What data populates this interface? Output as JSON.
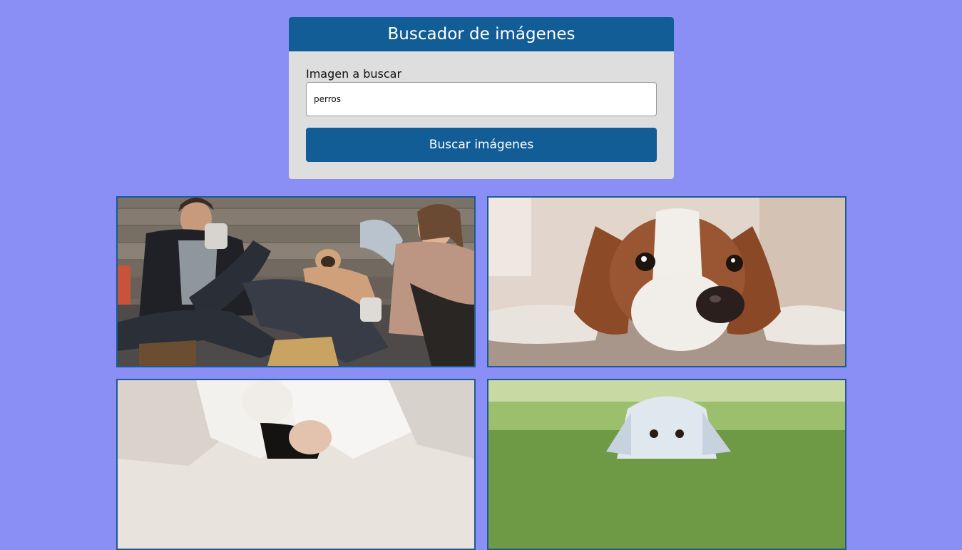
{
  "app": {
    "title": "Buscador de imágenes"
  },
  "search": {
    "label": "Imagen a buscar",
    "value": "perros",
    "button_label": "Buscar imágenes"
  },
  "results": [
    {
      "subject": "couple-with-pug-photo"
    },
    {
      "subject": "cavalier-spaniel-photo"
    },
    {
      "subject": "woman-with-dog-photo"
    },
    {
      "subject": "white-puppy-photo"
    }
  ],
  "colors": {
    "page_background": "#8a8ff6",
    "brand": "#135d97",
    "card_background": "#dedede",
    "result_border": "#1e5a92"
  }
}
